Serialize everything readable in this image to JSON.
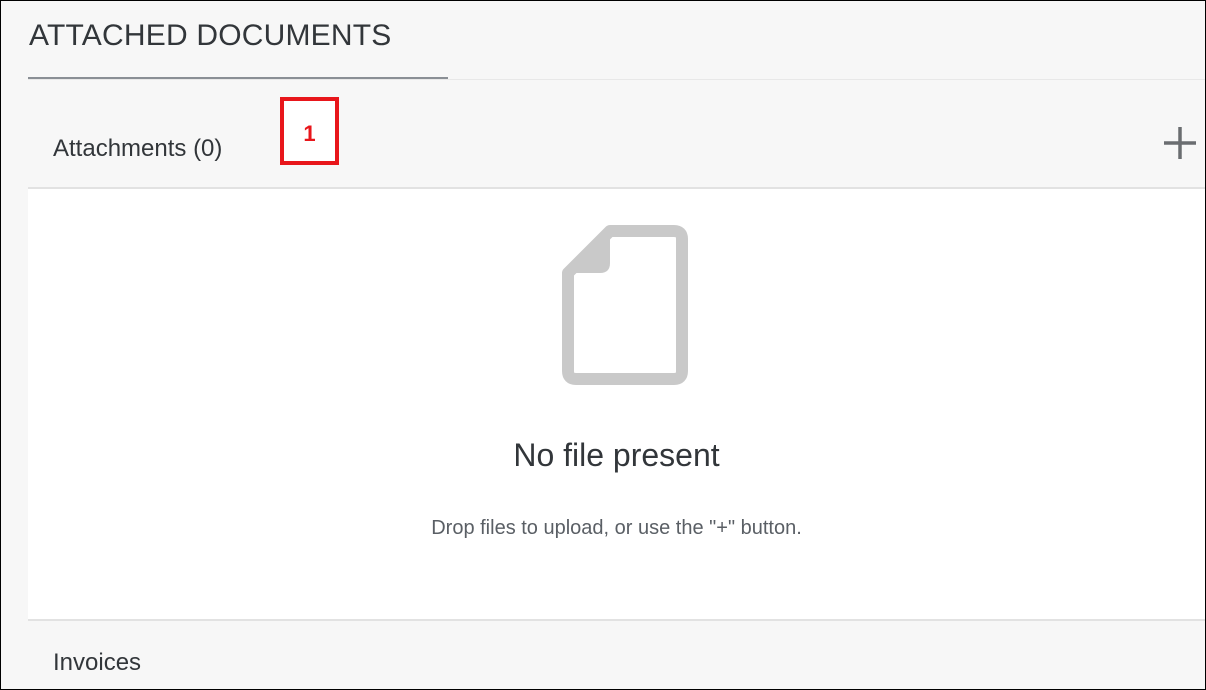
{
  "section": {
    "tab_label": "ATTACHED DOCUMENTS"
  },
  "attachments": {
    "title": "Attachments (0)",
    "add_icon": "plus-icon",
    "callout_label": "1",
    "empty_state": {
      "icon": "file-icon",
      "title": "No file present",
      "description": "Drop files to upload, or use the \"+\" button."
    }
  },
  "invoices": {
    "title": "Invoices"
  },
  "colors": {
    "callout_red": "#e8161b",
    "text_primary": "#32363a",
    "text_secondary": "#5a5f65",
    "icon_gray": "#c9c9c9",
    "panel_bg": "#f7f7f7"
  }
}
